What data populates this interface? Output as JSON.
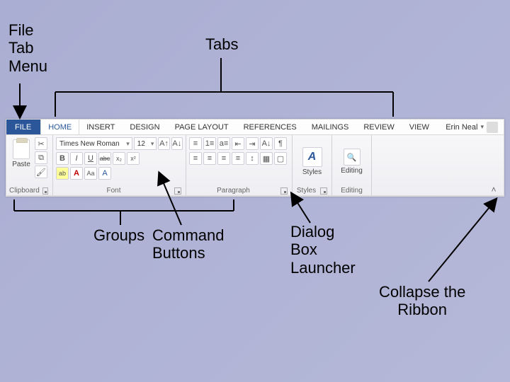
{
  "annotations": {
    "file_tab_menu": "File\nTab\nMenu",
    "tabs": "Tabs",
    "groups": "Groups",
    "command_buttons": "Command\nButtons",
    "dialog_box_launcher": "Dialog\nBox\nLauncher",
    "collapse_ribbon": "Collapse the\nRibbon"
  },
  "ribbon": {
    "tabs": {
      "file": "FILE",
      "home": "HOME",
      "insert": "INSERT",
      "design": "DESIGN",
      "page_layout": "PAGE LAYOUT",
      "references": "REFERENCES",
      "mailings": "MAILINGS",
      "review": "REVIEW",
      "view": "VIEW"
    },
    "user_name": "Erin Neal",
    "groups": {
      "clipboard": {
        "label": "Clipboard",
        "paste": "Paste"
      },
      "font": {
        "label": "Font",
        "family": "Times New Roman",
        "size": "12",
        "buttons": {
          "bold": "B",
          "italic": "I",
          "underline": "U",
          "strike": "abc",
          "sub": "x₂",
          "sup": "x²",
          "highlight": "ab",
          "color": "A",
          "case": "Aa",
          "clear": "A"
        }
      },
      "paragraph": {
        "label": "Paragraph"
      },
      "styles": {
        "label": "Styles",
        "btn": "Styles"
      },
      "editing": {
        "label": "Editing",
        "btn": "Editing"
      }
    }
  }
}
